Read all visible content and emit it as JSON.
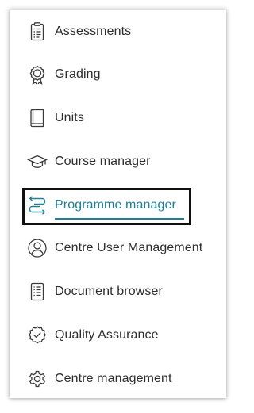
{
  "menu": {
    "items": [
      {
        "label": "Assessments",
        "icon": "clipboard-list-icon",
        "active": false
      },
      {
        "label": "Grading",
        "icon": "award-ribbon-icon",
        "active": false
      },
      {
        "label": "Units",
        "icon": "book-icon",
        "active": false
      },
      {
        "label": "Course manager",
        "icon": "graduation-cap-icon",
        "active": false
      },
      {
        "label": "Programme manager",
        "icon": "transfer-arrows-icon",
        "active": true
      },
      {
        "label": "Centre User Management",
        "icon": "user-circle-icon",
        "active": false
      },
      {
        "label": "Document browser",
        "icon": "document-list-icon",
        "active": false
      },
      {
        "label": "Quality Assurance",
        "icon": "badge-check-icon",
        "active": false
      },
      {
        "label": "Centre management",
        "icon": "gear-icon",
        "active": false
      }
    ]
  },
  "colors": {
    "text": "#2e2e2e",
    "accent": "#1f7f95",
    "icon": "#3a3a3a",
    "focus_outline": "#111111"
  }
}
